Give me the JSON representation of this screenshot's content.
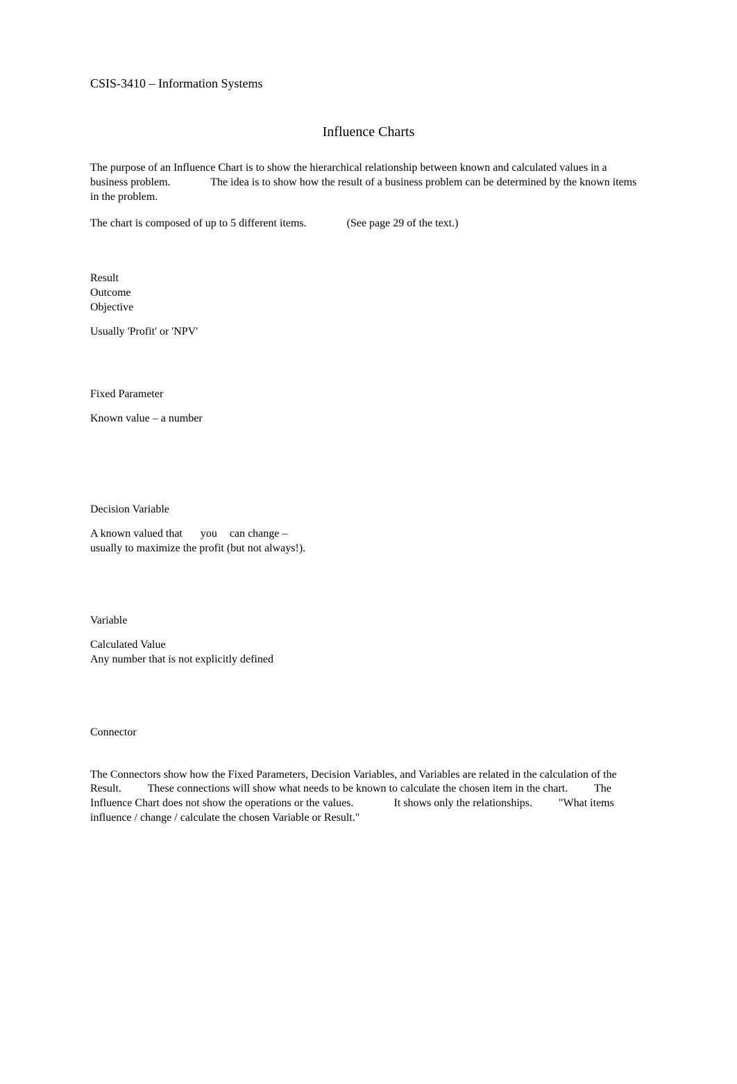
{
  "course_header": "CSIS-3410 – Information Systems",
  "title": "Influence Charts",
  "intro": {
    "seg1": "The purpose of an Influence Chart is to show the hierarchical relationship between known and calculated values in a business problem.",
    "seg2": "The idea is to show how the result of a business problem can be determined by the known items in the problem."
  },
  "composition": {
    "seg1": "The chart is composed of up to 5 different items.",
    "seg2": "(See page 29 of the text.)"
  },
  "items": {
    "result": {
      "l1": "Result",
      "l2": "Outcome",
      "l3": "Objective",
      "desc": "Usually 'Profit' or 'NPV'"
    },
    "fixed_parameter": {
      "l1": "Fixed Parameter",
      "desc": "Known value – a number"
    },
    "decision_variable": {
      "l1": "Decision Variable",
      "desc_seg1": "A known valued that",
      "desc_seg2": "you",
      "desc_seg3": "can change –",
      "desc_line2": "usually to maximize the profit (but not always!)."
    },
    "variable": {
      "l1": "Variable",
      "desc1": "Calculated Value",
      "desc2": "Any number that is not explicitly defined"
    },
    "connector": {
      "l1": "Connector"
    }
  },
  "connectors_para": {
    "seg1": "The Connectors show how the Fixed Parameters, Decision Variables, and Variables are related in the calculation of the Result.",
    "seg2": "These connections will show what needs to be known to calculate the chosen item in the chart.",
    "seg3": "The Influence Chart does not show the operations or the values.",
    "seg4": "It shows only the relationships.",
    "seg5": "\"What items influence / change / calculate the chosen Variable or Result.\""
  }
}
